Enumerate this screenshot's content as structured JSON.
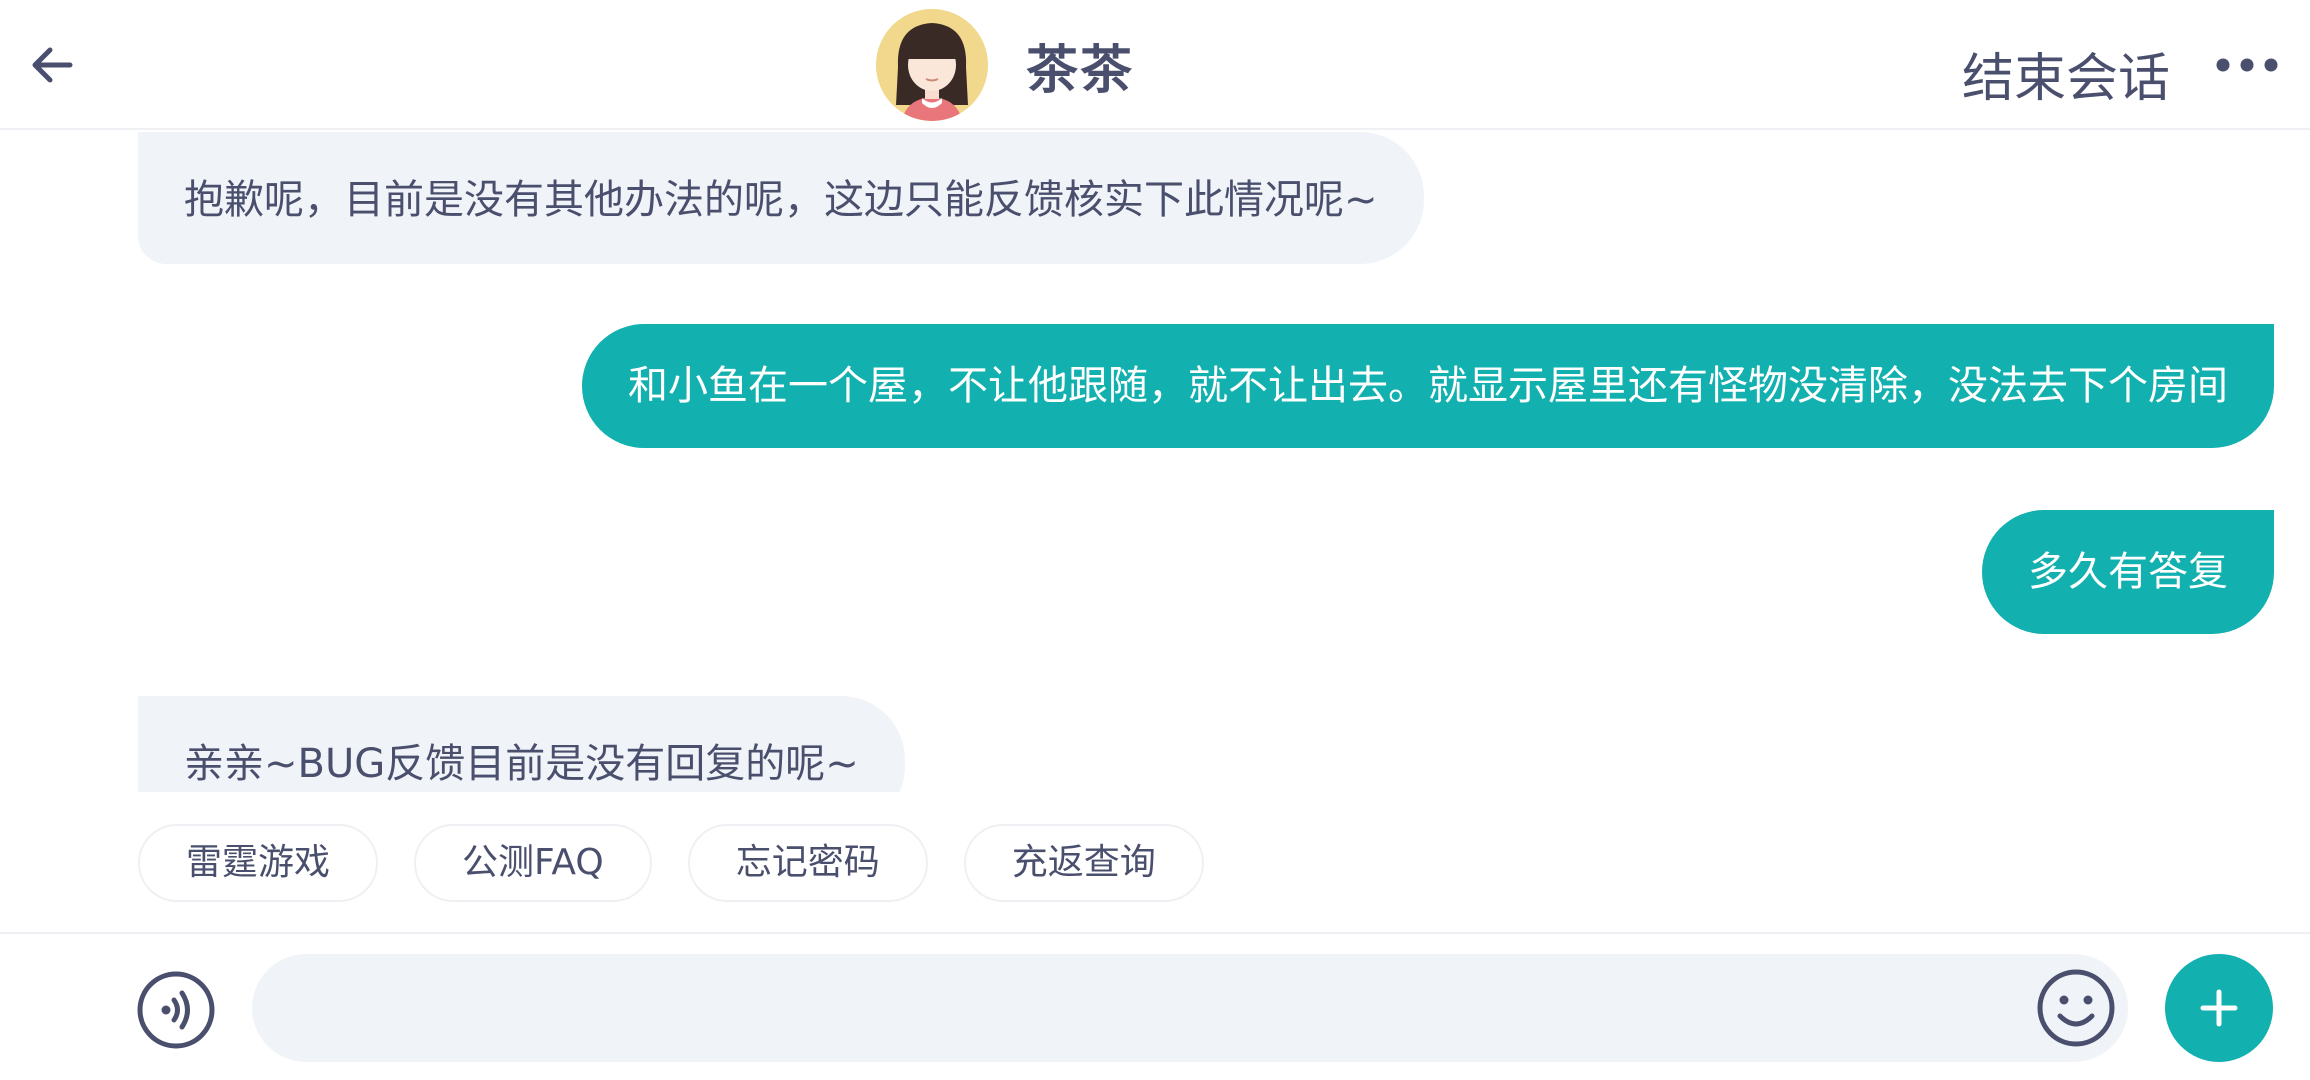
{
  "header": {
    "title": "茶茶",
    "end_label": "结束会话",
    "back_icon": "arrow-left-icon",
    "more_icon": "more-horizontal-icon"
  },
  "messages": [
    {
      "side": "incoming",
      "text": "抱歉呢，目前是没有其他办法的呢，这边只能反馈核实下此情况呢~"
    },
    {
      "side": "outgoing",
      "text": "和小鱼在一个屋，不让他跟随，就不让出去。就显示屋里还有怪物没清除，没法去下个房间"
    },
    {
      "side": "outgoing",
      "text": "多久有答复"
    },
    {
      "side": "incoming",
      "text": "亲亲~BUG反馈目前是没有回复的呢~"
    }
  ],
  "quick_replies": [
    "雷霆游戏",
    "公测FAQ",
    "忘记密码",
    "充返查询"
  ],
  "input": {
    "value": "",
    "placeholder": "",
    "voice_icon": "voice-icon",
    "emoji_icon": "emoji-icon",
    "plus_icon": "plus-icon"
  },
  "colors": {
    "accent": "#12b0af",
    "incoming_bubble": "#f0f3f7",
    "text": "#4a4f6e",
    "divider": "#eef0f3"
  }
}
